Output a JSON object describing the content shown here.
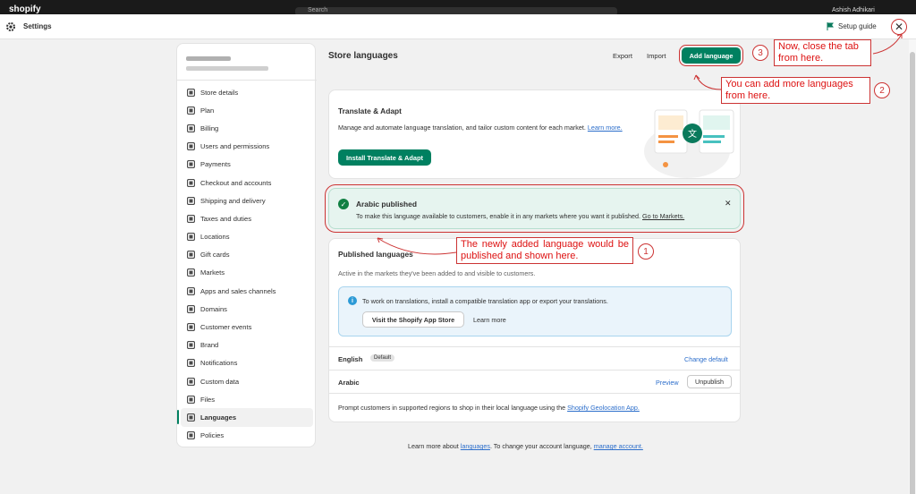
{
  "topbar": {
    "logo": "shopify",
    "search_placeholder": "Search",
    "user": "Ashish Adhikari"
  },
  "header": {
    "title": "Settings",
    "setup_guide": "Setup guide"
  },
  "sidebar": {
    "items": [
      {
        "label": "Store details",
        "icon": "store-icon"
      },
      {
        "label": "Plan",
        "icon": "plan-icon"
      },
      {
        "label": "Billing",
        "icon": "billing-icon"
      },
      {
        "label": "Users and permissions",
        "icon": "user-icon"
      },
      {
        "label": "Payments",
        "icon": "payments-icon"
      },
      {
        "label": "Checkout and accounts",
        "icon": "checkout-icon"
      },
      {
        "label": "Shipping and delivery",
        "icon": "truck-icon"
      },
      {
        "label": "Taxes and duties",
        "icon": "taxes-icon"
      },
      {
        "label": "Locations",
        "icon": "location-icon"
      },
      {
        "label": "Gift cards",
        "icon": "gift-icon"
      },
      {
        "label": "Markets",
        "icon": "globe-icon"
      },
      {
        "label": "Apps and sales channels",
        "icon": "apps-icon"
      },
      {
        "label": "Domains",
        "icon": "domains-icon"
      },
      {
        "label": "Customer events",
        "icon": "events-icon"
      },
      {
        "label": "Brand",
        "icon": "brand-icon"
      },
      {
        "label": "Notifications",
        "icon": "bell-icon"
      },
      {
        "label": "Custom data",
        "icon": "data-icon"
      },
      {
        "label": "Files",
        "icon": "paperclip-icon"
      },
      {
        "label": "Languages",
        "icon": "language-icon"
      },
      {
        "label": "Policies",
        "icon": "policies-icon"
      }
    ]
  },
  "main": {
    "title": "Store languages",
    "export": "Export",
    "import": "Import",
    "add_language": "Add language",
    "translate": {
      "title": "Translate & Adapt",
      "desc": "Manage and automate language translation, and tailor custom content for each market.",
      "learn": "Learn more.",
      "button": "Install Translate & Adapt"
    },
    "banner": {
      "title": "Arabic published",
      "desc": "To make this language available to customers, enable it in any markets where you want it published.",
      "link": "Go to Markets."
    },
    "published": {
      "title": "Published languages",
      "sub": "Active in the markets they've been added to and visible to customers.",
      "info_text": "To work on translations, install a compatible translation app or export your translations.",
      "visit_store": "Visit the Shopify App Store",
      "learn_more": "Learn more",
      "english": "English",
      "default_badge": "Default",
      "change_default": "Change default",
      "arabic": "Arabic",
      "preview": "Preview",
      "unpublish": "Unpublish",
      "prompt": "Prompt customers in supported regions to shop in their local language using the",
      "geo_link": "Shopify Geolocation App."
    },
    "footer": {
      "pre": "Learn more about",
      "languages_link": "languages",
      "mid": ". To change your account language,",
      "account_link": "manage account."
    }
  },
  "annotations": {
    "a1": "The newly added language would be published and shown here.",
    "a2": "You can add more languages from here.",
    "a3": "Now, close the tab from here.",
    "n1": "1",
    "n2": "2",
    "n3": "3"
  },
  "colors": {
    "accent": "#008060",
    "annotation": "#cc3333",
    "link": "#2c6ecb"
  }
}
